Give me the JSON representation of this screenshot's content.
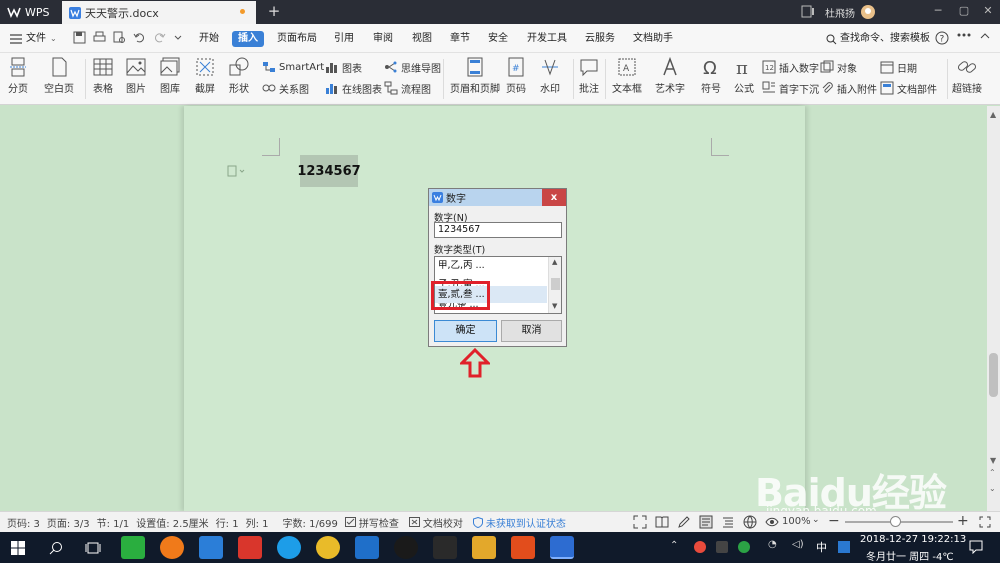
{
  "app": {
    "name": "WPS"
  },
  "tab": {
    "filename": "天天警示.docx"
  },
  "user": {
    "name": "杜飛扬"
  },
  "menu": {
    "file": "文件",
    "items": [
      "开始",
      "插入",
      "页面布局",
      "引用",
      "审阅",
      "视图",
      "章节",
      "安全",
      "开发工具",
      "云服务",
      "文档助手"
    ],
    "search": "查找命令、搜索模板"
  },
  "ribbon": {
    "fenye": "分页",
    "kongbaiye": "空白页",
    "biaoge": "表格",
    "tupian": "图片",
    "tuku": "图库",
    "jieping": "截屏",
    "xingzhuang": "形状",
    "smartart": "SmartArt",
    "guanxitu": "关系图",
    "tubiao": "图表",
    "zaixiantubiao": "在线图表",
    "siweidaotu": "思维导图",
    "liuchengtu": "流程图",
    "yemeiyejiao": "页眉和页脚",
    "yema": "页码",
    "shuiyin": "水印",
    "pizhu": "批注",
    "wenbenkuang": "文本框",
    "yishuzi": "艺术字",
    "fuhao": "符号",
    "gongshi": "公式",
    "charushuzi": "插入数字",
    "duixiang": "对象",
    "riqi": "日期",
    "shouzixiachen": "首字下沉",
    "charufujian": "插入附件",
    "wendangbujian": "文档部件",
    "chaolianjie": "超链接"
  },
  "doc": {
    "selected_text": "1234567"
  },
  "dialog": {
    "title": "数字",
    "number_label": "数字(N)",
    "number_value": "1234567",
    "type_label": "数字类型(T)",
    "options": [
      "甲,乙,丙 ...",
      "子,丑,寅 ...",
      "壹,贰,叁 ...",
      "壹元整 ..."
    ],
    "ok": "确定",
    "cancel": "取消",
    "close": "x"
  },
  "status": {
    "pagenum": "页码: 3",
    "pages": "页面: 3/3",
    "section": "节: 1/1",
    "setting": "设置值: 2.5厘米",
    "row": "行: 1",
    "col": "列: 1",
    "words": "字数: 1/699",
    "spell": "拼写检查",
    "proof": "文档校对",
    "auth": "未获取到认证状态",
    "zoom": "100%"
  },
  "taskbar": {
    "ime": "中",
    "datetime": "2018-12-27  19:22:13",
    "date_cn": "冬月廿一 周四 -4℃"
  },
  "watermark": {
    "text": "Baidu经验",
    "url": "jingyan.baidu.com"
  },
  "colors": {
    "accent": "#3a80d6",
    "doc_bg": "#c9e3c9",
    "highlight": "#e0202a"
  }
}
